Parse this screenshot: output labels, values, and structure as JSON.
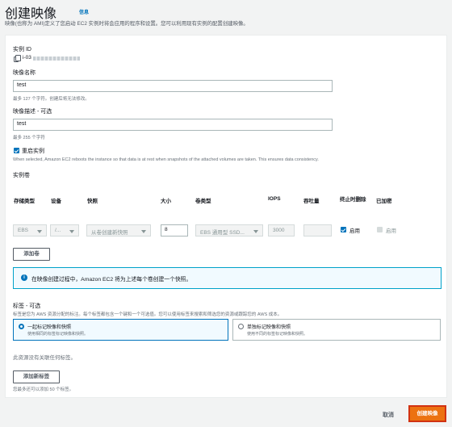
{
  "header": {
    "title": "创建映像",
    "info_link": "信息",
    "description": "映像(也称为 AMI)定义了您启动 EC2 实例时将会应用的程序和设置。您可以利用现有实例的配置创建映像。"
  },
  "instance_id": {
    "label": "实例 ID",
    "value": "i-03"
  },
  "image_name": {
    "label": "映像名称",
    "value": "test",
    "hint": "最多 127 个字符。创建后将无法修改。"
  },
  "image_description": {
    "label": "映像描述 - 可选",
    "value": "test",
    "hint": "最多 255 个字符"
  },
  "reboot": {
    "label": "重启实例",
    "checked": true,
    "hint": "When selected, Amazon EC2 reboots the instance so that data is at rest when snapshots of the attached volumes are taken. This ensures data consistency."
  },
  "volumes": {
    "title": "实例卷",
    "headers": [
      "存储类型",
      "设备",
      "快照",
      "大小",
      "卷类型",
      "IOPS",
      "吞吐量",
      "终止时删除",
      "已加密"
    ],
    "row": {
      "storage_type": "EBS",
      "device": "/...",
      "snapshot": "从卷创建新快照",
      "size": "8",
      "volume_type": "EBS 通用型 SSD...",
      "iops": "3000",
      "throughput": "",
      "delete_on_termination": "启用",
      "delete_checked": true,
      "encrypted": "启用",
      "encrypted_checked": false
    },
    "add_volume_button": "添加卷"
  },
  "info_alert": "在映像创建过程中，Amazon EC2 将为上述每个卷创建一个快照。",
  "tags": {
    "title": "标签 - 可选",
    "description": "标签是您为 AWS 资源分配的标注。每个标签都包含一个键和一个可选值。您可以使用标签来搜索和筛选您的资源或跟踪您的 AWS 成本。",
    "option_together": {
      "title": "一起标记映像和快照",
      "description": "使用相同的标签标记映像和快照。",
      "selected": true
    },
    "option_separate": {
      "title": "单独标记映像和快照",
      "description": "使用不同的标签标记映像和快照。",
      "selected": false
    },
    "empty_text": "此资源没有关联任何标签。",
    "add_tag_button": "添加新标签",
    "limit_hint": "您最多还可以添加 50 个标签。"
  },
  "footer": {
    "cancel": "取消",
    "create": "创建映像"
  },
  "colors": {
    "primary": "#ec7211",
    "link": "#0073bb",
    "highlight_border": "#d13212"
  }
}
